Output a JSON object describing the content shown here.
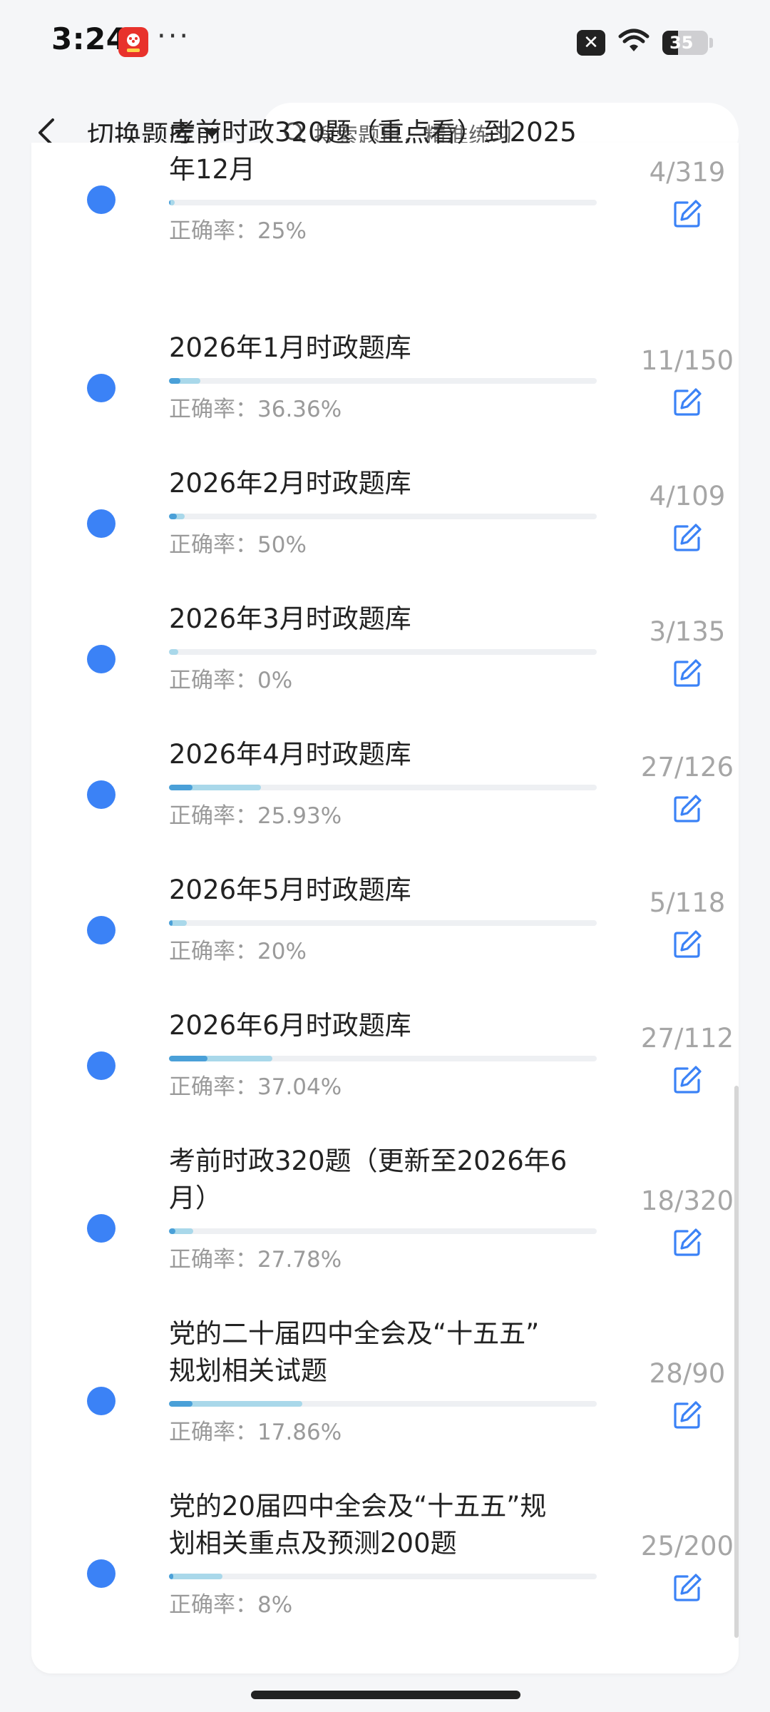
{
  "status_bar": {
    "time": "3:24",
    "app_badge_icon": "shopping-app-icon",
    "more_dots": "···",
    "close_box": "✕",
    "battery": "35",
    "battery_level": 0.35
  },
  "header": {
    "back_icon": "chevron-left-icon",
    "switch_bank_label": "切换题库",
    "search_placeholder": "搜索题目，精准练习"
  },
  "colors": {
    "dot": "#3b82f6",
    "progress_track": "#eef0f3",
    "progress_attempted": "#a9d8ea",
    "progress_correct": "#4aa0d8",
    "edit_icon": "#3b82f6"
  },
  "question_banks": [
    {
      "title": "考前时政320题（重点看）到2025年12月",
      "title_line1": "考前时政320题（重点看）到2025",
      "title_line2": "年12月",
      "accuracy": "正确率：25%",
      "done": 4,
      "total": 319,
      "count": "4/319"
    },
    {
      "title": "2026年1月时政题库",
      "accuracy": "正确率：36.36%",
      "done": 11,
      "total": 150,
      "count": "11/150"
    },
    {
      "title": "2026年2月时政题库",
      "accuracy": "正确率：50%",
      "done": 4,
      "total": 109,
      "count": "4/109"
    },
    {
      "title": "2026年3月时政题库",
      "accuracy": "正确率：0%",
      "done": 3,
      "total": 135,
      "count": "3/135"
    },
    {
      "title": "2026年4月时政题库",
      "accuracy": "正确率：25.93%",
      "done": 27,
      "total": 126,
      "count": "27/126"
    },
    {
      "title": "2026年5月时政题库",
      "accuracy": "正确率：20%",
      "done": 5,
      "total": 118,
      "count": "5/118"
    },
    {
      "title": "2026年6月时政题库",
      "accuracy": "正确率：37.04%",
      "done": 27,
      "total": 112,
      "count": "27/112"
    },
    {
      "title": "考前时政320题（更新至2026年6月）",
      "title_line1": "考前时政320题（更新至2026年6",
      "title_line2": "月）",
      "accuracy": "正确率：27.78%",
      "done": 18,
      "total": 320,
      "count": "18/320"
    },
    {
      "title": "党的二十届四中全会及“十五五”规划相关试题",
      "title_line1": "党的二十届四中全会及“十五五”",
      "title_line2": "规划相关试题",
      "accuracy": "正确率：17.86%",
      "done": 28,
      "total": 90,
      "count": "28/90"
    },
    {
      "title": "党的20届四中全会及“十五五”规划相关重点及预测200题",
      "title_line1": "党的20届四中全会及“十五五”规",
      "title_line2": "划相关重点及预测200题",
      "accuracy": "正确率：8%",
      "done": 25,
      "total": 200,
      "count": "25/200"
    }
  ]
}
